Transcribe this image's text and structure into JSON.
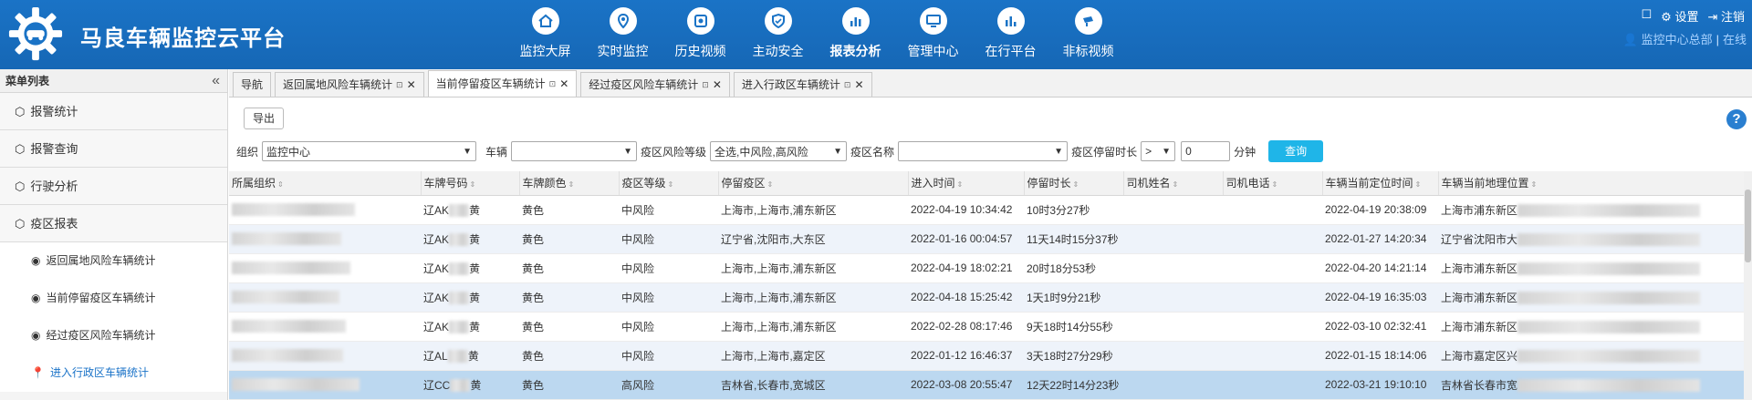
{
  "header": {
    "app_title": "马良车辆监控云平台",
    "nav": [
      {
        "label": "监控大屏",
        "icon": "home-icon"
      },
      {
        "label": "实时监控",
        "icon": "location-pin-icon"
      },
      {
        "label": "历史视频",
        "icon": "video-icon"
      },
      {
        "label": "主动安全",
        "icon": "shield-icon"
      },
      {
        "label": "报表分析",
        "icon": "bar-chart-icon",
        "active": true
      },
      {
        "label": "管理中心",
        "icon": "monitor-icon"
      },
      {
        "label": "在行平台",
        "icon": "bar-chart-icon"
      },
      {
        "label": "非标视频",
        "icon": "camera-icon"
      }
    ],
    "settings_label": "设置",
    "logout_label": "注销",
    "user_name": "监控中心总部",
    "user_separator": "|",
    "user_status": "在线"
  },
  "sidebar": {
    "title": "菜单列表",
    "collapse_glyph": "«",
    "menu": [
      {
        "label": "报警统计"
      },
      {
        "label": "报警查询"
      },
      {
        "label": "行驶分析"
      },
      {
        "label": "疫区报表"
      }
    ],
    "submenu": [
      {
        "label": "返回属地风险车辆统计"
      },
      {
        "label": "当前停留疫区车辆统计"
      },
      {
        "label": "经过疫区风险车辆统计"
      },
      {
        "label": "进入行政区车辆统计",
        "active": true
      }
    ]
  },
  "tabs": [
    {
      "label": "导航"
    },
    {
      "label": "返回属地风险车辆统计"
    },
    {
      "label": "当前停留疫区车辆统计",
      "active": true
    },
    {
      "label": "经过疫区风险车辆统计"
    },
    {
      "label": "进入行政区车辆统计"
    }
  ],
  "toolbar": {
    "export_label": "导出",
    "help_glyph": "?",
    "org_label": "组织",
    "org_value": "监控中心",
    "vehicle_label": "车辆",
    "vehicle_value": "",
    "risk_label": "疫区风险等级",
    "risk_value": "全选,中风险,高风险",
    "zone_label": "疫区名称",
    "zone_value": "",
    "duration_label": "疫区停留时长",
    "duration_op": ">",
    "duration_value": "0",
    "duration_unit": "分钟",
    "query_label": "查询"
  },
  "table": {
    "columns": [
      "所属组织",
      "车牌号码",
      "车牌颜色",
      "疫区等级",
      "停留疫区",
      "进入时间",
      "停留时长",
      "司机姓名",
      "司机电话",
      "车辆当前定位时间",
      "车辆当前地理位置"
    ],
    "rows": [
      {
        "plate_prefix": "辽AK",
        "plate_suffix": "黄",
        "color": "黄色",
        "level": "中风险",
        "zone": "上海市,上海市,浦东新区",
        "enter": "2022-04-19 10:34:42",
        "stay": "10时3分27秒",
        "driver": "",
        "phone": "",
        "loc_time": "2022-04-19 20:38:09",
        "loc": "上海市浦东新区"
      },
      {
        "plate_prefix": "辽AK",
        "plate_suffix": "黄",
        "color": "黄色",
        "level": "中风险",
        "zone": "辽宁省,沈阳市,大东区",
        "enter": "2022-01-16 00:04:57",
        "stay": "11天14时15分37秒",
        "driver": "",
        "phone": "",
        "loc_time": "2022-01-27 14:20:34",
        "loc": "辽宁省沈阳市大"
      },
      {
        "plate_prefix": "辽AK",
        "plate_suffix": "黄",
        "color": "黄色",
        "level": "中风险",
        "zone": "上海市,上海市,浦东新区",
        "enter": "2022-04-19 18:02:21",
        "stay": "20时18分53秒",
        "driver": "",
        "phone": "",
        "loc_time": "2022-04-20 14:21:14",
        "loc": "上海市浦东新区"
      },
      {
        "plate_prefix": "辽AK",
        "plate_suffix": "黄",
        "color": "黄色",
        "level": "中风险",
        "zone": "上海市,上海市,浦东新区",
        "enter": "2022-04-18 15:25:42",
        "stay": "1天1时9分21秒",
        "driver": "",
        "phone": "",
        "loc_time": "2022-04-19 16:35:03",
        "loc": "上海市浦东新区"
      },
      {
        "plate_prefix": "辽AK",
        "plate_suffix": "黄",
        "color": "黄色",
        "level": "中风险",
        "zone": "上海市,上海市,浦东新区",
        "enter": "2022-02-28 08:17:46",
        "stay": "9天18时14分55秒",
        "driver": "",
        "phone": "",
        "loc_time": "2022-03-10 02:32:41",
        "loc": "上海市浦东新区"
      },
      {
        "plate_prefix": "辽AL",
        "plate_suffix": "黄",
        "color": "黄色",
        "level": "中风险",
        "zone": "上海市,上海市,嘉定区",
        "enter": "2022-01-12 16:46:37",
        "stay": "3天18时27分29秒",
        "driver": "",
        "phone": "",
        "loc_time": "2022-01-15 18:14:06",
        "loc": "上海市嘉定区兴"
      },
      {
        "plate_prefix": "辽CC",
        "plate_suffix": "黄",
        "color": "黄色",
        "level": "高风险",
        "zone": "吉林省,长春市,宽城区",
        "enter": "2022-03-08 20:55:47",
        "stay": "12天22时14分23秒",
        "driver": "",
        "phone": "",
        "loc_time": "2022-03-21 19:10:10",
        "loc": "吉林省长春市宽"
      }
    ]
  },
  "colors": {
    "header_bg": "#1a73c6",
    "accent": "#1fb5e8",
    "active_link": "#1b73c8",
    "selected_row": "#bcd8f0"
  }
}
